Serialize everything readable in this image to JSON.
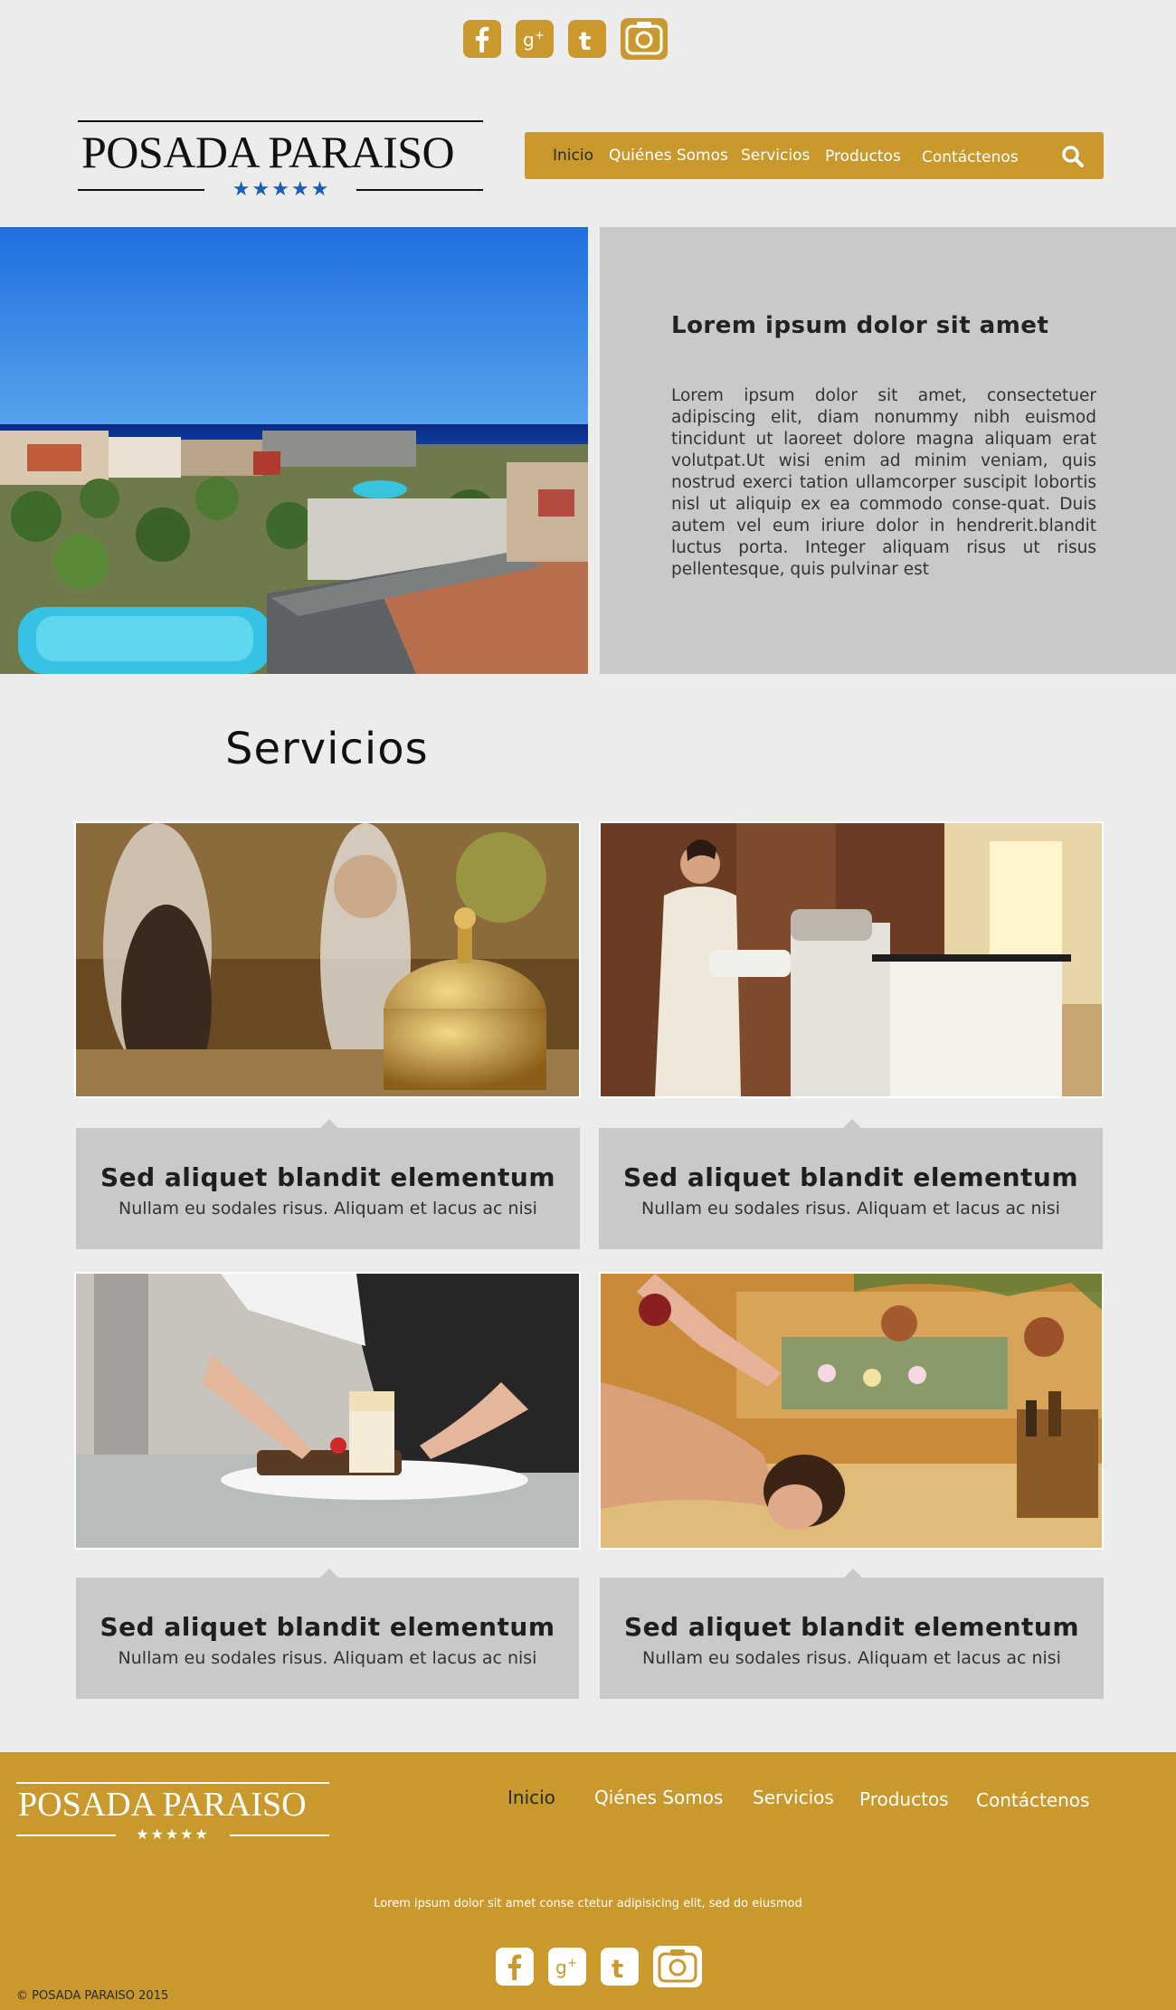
{
  "header": {
    "social": [
      "facebook-icon",
      "google-plus-icon",
      "tumblr-icon",
      "instagram-icon"
    ],
    "logo": {
      "title": "POSADA PARAISO",
      "stars": "★★★★★"
    },
    "nav": [
      {
        "label": "Inicio",
        "active": true
      },
      {
        "label": "Quiénes Somos"
      },
      {
        "label": "Servicios"
      },
      {
        "label": "Productos"
      },
      {
        "label": "Contáctenos"
      }
    ],
    "search_icon": "search-icon"
  },
  "hero": {
    "title": "Lorem ipsum dolor sit amet",
    "text": "Lorem ipsum dolor sit amet, consectetuer adipiscing elit, diam nonummy nibh euismod tincidunt ut laoreet dolore magna aliquam erat volutpat.Ut wisi enim ad minim veniam, quis nostrud exerci tation ullamcorper suscipit lobortis nisl ut aliquip ex ea commodo conse-quat. Duis autem vel eum iriure dolor in hendrerit.blandit luctus porta. Integer aliquam risus ut risus pellentesque, quis pulvinar est"
  },
  "services": {
    "title": "Servicios",
    "cards": [
      {
        "title": "Sed aliquet blandit elementum",
        "subtitle": "Nullam eu sodales risus. Aliquam et lacus ac nisi"
      },
      {
        "title": "Sed aliquet blandit elementum",
        "subtitle": "Nullam eu sodales risus. Aliquam et lacus ac nisi"
      },
      {
        "title": "Sed aliquet blandit elementum",
        "subtitle": "Nullam eu sodales risus. Aliquam et lacus ac nisi"
      },
      {
        "title": "Sed aliquet blandit elementum",
        "subtitle": "Nullam eu sodales risus. Aliquam et lacus ac nisi"
      }
    ]
  },
  "footer": {
    "logo": {
      "title": "POSADA PARAISO",
      "stars": "★★★★★"
    },
    "nav": [
      {
        "label": "Inicio",
        "active": true
      },
      {
        "label": "Qiénes Somos"
      },
      {
        "label": "Servicios"
      },
      {
        "label": "Productos"
      },
      {
        "label": "Contáctenos"
      }
    ],
    "text": "Lorem ipsum dolor sit amet conse ctetur adipisicing elit, sed do eiusmod",
    "copyright": "© POSADA PARAISO 2015"
  },
  "colors": {
    "gold": "#c9992d",
    "panel": "#c9c9c9",
    "background": "#ececec",
    "star_blue": "#1a5fb4"
  }
}
